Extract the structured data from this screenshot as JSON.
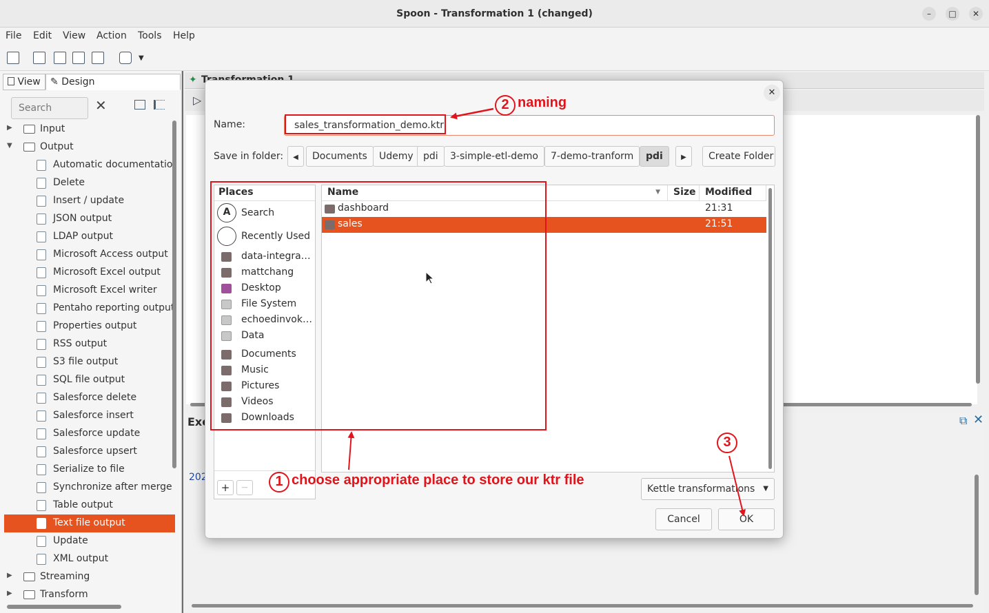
{
  "window": {
    "title": "Spoon - Transformation 1 (changed)",
    "minimize": "–",
    "maximize": "□",
    "close": "✕"
  },
  "menubar": [
    "File",
    "Edit",
    "View",
    "Action",
    "Tools",
    "Help"
  ],
  "left_panel": {
    "tabs": [
      "View",
      "Design"
    ],
    "search_placeholder": "Search",
    "clear": "✕",
    "tree": [
      {
        "label": "Input",
        "type": "folder",
        "expanded": false
      },
      {
        "label": "Output",
        "type": "folder",
        "expanded": true
      },
      {
        "label": "Automatic documentatio",
        "type": "step"
      },
      {
        "label": "Delete",
        "type": "step"
      },
      {
        "label": "Insert / update",
        "type": "step"
      },
      {
        "label": "JSON output",
        "type": "step"
      },
      {
        "label": "LDAP output",
        "type": "step"
      },
      {
        "label": "Microsoft Access output",
        "type": "step"
      },
      {
        "label": "Microsoft Excel output",
        "type": "step"
      },
      {
        "label": "Microsoft Excel writer",
        "type": "step"
      },
      {
        "label": "Pentaho reporting output",
        "type": "step"
      },
      {
        "label": "Properties output",
        "type": "step"
      },
      {
        "label": "RSS output",
        "type": "step"
      },
      {
        "label": "S3 file output",
        "type": "step"
      },
      {
        "label": "SQL file output",
        "type": "step"
      },
      {
        "label": "Salesforce delete",
        "type": "step"
      },
      {
        "label": "Salesforce insert",
        "type": "step"
      },
      {
        "label": "Salesforce update",
        "type": "step"
      },
      {
        "label": "Salesforce upsert",
        "type": "step"
      },
      {
        "label": "Serialize to file",
        "type": "step"
      },
      {
        "label": "Synchronize after merge",
        "type": "step"
      },
      {
        "label": "Table output",
        "type": "step"
      },
      {
        "label": "Text file output",
        "type": "step",
        "selected": true
      },
      {
        "label": "Update",
        "type": "step"
      },
      {
        "label": "XML output",
        "type": "step"
      },
      {
        "label": "Streaming",
        "type": "folder",
        "expanded": false
      },
      {
        "label": "Transform",
        "type": "folder",
        "expanded": false
      }
    ]
  },
  "canvas": {
    "tab_title": "Transformation 1",
    "exec_label": "Exe",
    "log_text": "202"
  },
  "dialog": {
    "close": "✕",
    "name_label": "Name:",
    "name_value": "sales_transformation_demo.ktr",
    "folder_label": "Save in folder:",
    "breadcrumbs": [
      "Documents",
      "Udemy",
      "pdi",
      "3-simple-etl-demo",
      "7-demo-tranform",
      "pdi"
    ],
    "create_folder": "Create Folder",
    "places_header": "Places",
    "places": [
      {
        "label": "Search",
        "icon": "search-icon"
      },
      {
        "label": "Recently Used",
        "icon": "clock-icon"
      },
      {
        "label": "data-integra…",
        "icon": "folder-icon"
      },
      {
        "label": "mattchang",
        "icon": "home-icon"
      },
      {
        "label": "Desktop",
        "icon": "desktop-icon"
      },
      {
        "label": "File System",
        "icon": "drive-icon"
      },
      {
        "label": "echoedinvok…",
        "icon": "drive-icon"
      },
      {
        "label": "Data",
        "icon": "drive-icon"
      },
      {
        "label": "Documents",
        "icon": "documents-icon"
      },
      {
        "label": "Music",
        "icon": "music-icon"
      },
      {
        "label": "Pictures",
        "icon": "pictures-icon"
      },
      {
        "label": "Videos",
        "icon": "videos-icon"
      },
      {
        "label": "Downloads",
        "icon": "downloads-icon"
      }
    ],
    "add": "+",
    "remove": "—",
    "columns": {
      "name": "Name",
      "size": "Size",
      "modified": "Modified"
    },
    "files": [
      {
        "name": "dashboard",
        "size": "",
        "modified": "21:31"
      },
      {
        "name": "sales",
        "size": "",
        "modified": "21:51",
        "selected": true
      }
    ],
    "filter": "Kettle transformations",
    "cancel": "Cancel",
    "ok": "OK"
  },
  "annotations": {
    "step1_num": "1",
    "step1_text": "choose appropriate place to store our ktr file",
    "step2_num": "2",
    "step2_text": "naming",
    "step3_num": "3",
    "color": "#e1141b"
  },
  "colors": {
    "accent": "#e6531f",
    "annotation": "#e1141b"
  }
}
